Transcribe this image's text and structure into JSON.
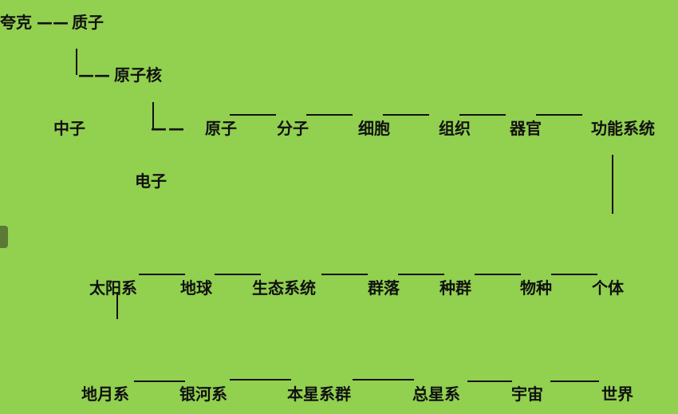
{
  "row1": {
    "quark": "夸克",
    "dash": "——",
    "proton": "质子"
  },
  "row2": {
    "dash": "——",
    "nucleus": "原子核"
  },
  "row3": {
    "neutron": "中子",
    "dash": "——",
    "atom": "原子",
    "molecule": "分子",
    "cell": "细胞",
    "tissue": "组织",
    "organ": "器官",
    "functional_system": "功能系统"
  },
  "row4": {
    "electron": "电子"
  },
  "row5": {
    "solar_system": "太阳系",
    "earth": "地球",
    "ecosystem": "生态系统",
    "community": "群落",
    "population": "种群",
    "species": "物种",
    "individual": "个体"
  },
  "row6": {
    "earth_moon_system": "地月系",
    "galaxy": "银河系",
    "local_group": "本星系群",
    "supergalaxy": "总星系",
    "universe": "宇宙",
    "world": "世界"
  },
  "colors": {
    "background": "#92d050",
    "ink": "#111111"
  }
}
